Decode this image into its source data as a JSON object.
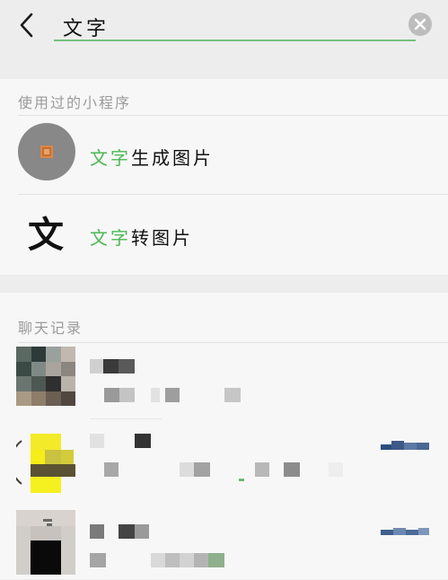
{
  "search": {
    "query": "文字"
  },
  "mini_programs": {
    "section_label": "使用过的小程序",
    "items": [
      {
        "highlight": "文字",
        "rest": "生成图片"
      },
      {
        "highlight": "文字",
        "rest": "转图片",
        "icon_glyph": "文"
      }
    ]
  },
  "chat_records": {
    "section_label": "聊天记录"
  },
  "colors": {
    "highlight": "#4bb853",
    "input_underline": "#74c27f",
    "background": "#ededed",
    "card": "#f7f7f7"
  },
  "icons": {
    "back": "chevron-left-icon",
    "clear": "clear-circle-icon"
  }
}
